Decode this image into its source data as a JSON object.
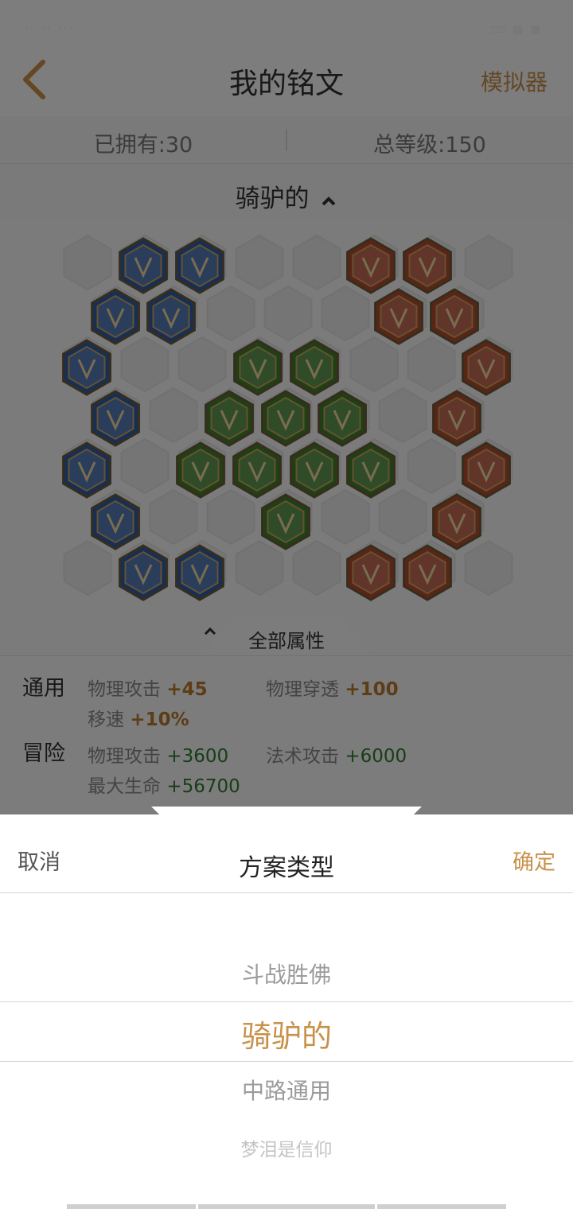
{
  "header": {
    "title": "我的铭文",
    "right_label": "模拟器",
    "back_icon": "chevron-left-icon"
  },
  "stats": {
    "owned": "已拥有:30",
    "total_level": "总等级:150"
  },
  "scheme": {
    "current": "骑驴的"
  },
  "board": {
    "tab_label": "全部属性",
    "rune_colors": {
      "blue": "#2f5fa8",
      "red": "#b54b2d",
      "green": "#3f7f2a"
    }
  },
  "attributes": {
    "general": {
      "label": "通用",
      "items": [
        {
          "name": "物理攻击",
          "value": "+45"
        },
        {
          "name": "物理穿透",
          "value": "+100"
        },
        {
          "name": "移速",
          "value": "+10%"
        }
      ]
    },
    "adventure": {
      "label": "冒险",
      "items": [
        {
          "name": "物理攻击",
          "value": "+3600"
        },
        {
          "name": "法术攻击",
          "value": "+6000"
        },
        {
          "name": "最大生命",
          "value": "+56700"
        }
      ]
    }
  },
  "sheet": {
    "cancel": "取消",
    "title": "方案类型",
    "confirm": "确定",
    "options": [
      "斗战胜佛",
      "骑驴的",
      "中路通用",
      "梦泪是信仰"
    ],
    "selected": "骑驴的",
    "accent": "#c8914a"
  }
}
